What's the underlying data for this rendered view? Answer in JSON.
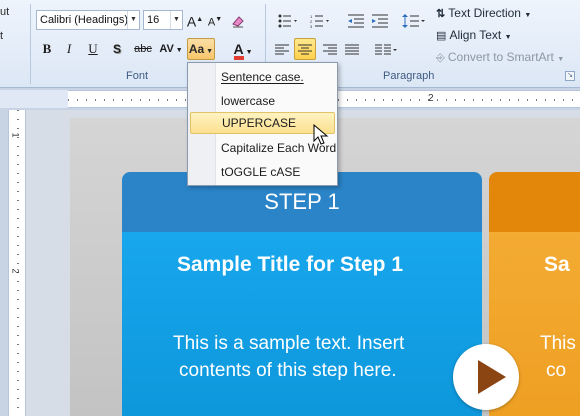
{
  "ribbon": {
    "clipboard_fragments": [
      "ut",
      "t"
    ],
    "font_name": "Calibri (Headings)",
    "font_size": "16",
    "grow_font_label": "A",
    "shrink_font_label": "A",
    "change_case_label": "Aa",
    "bold_label": "B",
    "italic_label": "I",
    "underline_label": "U",
    "shadow_label": "S",
    "strike_label": "abc",
    "spacing_label": "AV",
    "font_color_label": "A",
    "font_group_label": "Font",
    "paragraph_group_label": "Paragraph",
    "text_direction_label": "Text Direction",
    "align_text_label": "Align Text",
    "smartart_label": "Convert to SmartArt",
    "accent_color": "#ffd14b",
    "font_color_swatch": "#e03c31"
  },
  "change_case_menu": {
    "items": [
      "Sentence case.",
      "lowercase",
      "UPPERCASE",
      "Capitalize Each Word",
      "tOGGLE cASE"
    ],
    "highlighted": "UPPERCASE"
  },
  "ruler": {
    "h_numbers": [
      "1",
      "2"
    ],
    "v_numbers": [
      "1",
      "2"
    ]
  },
  "slide": {
    "step_title": "STEP 1",
    "sample_title": "Sample Title for Step 1",
    "sample_text_line1": "This is a sample text. Insert",
    "sample_text_line2": "contents of this step here.",
    "orange_title_fragment": "Sa",
    "orange_text_line1": "This",
    "orange_text_line2": "co",
    "blue_color": "#18a6ec",
    "orange_color": "#f4ab33",
    "play_icon": "play-icon"
  }
}
